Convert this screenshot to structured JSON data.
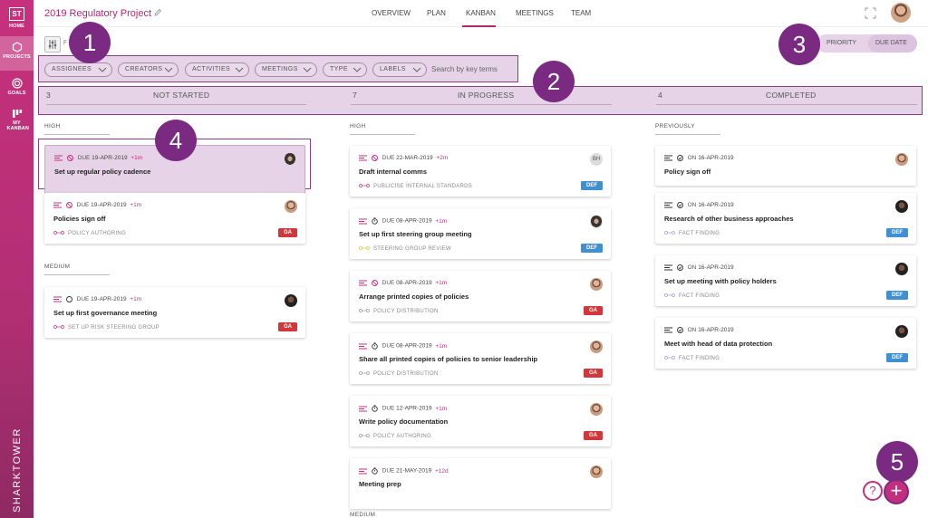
{
  "sidebar": {
    "logo": "ST",
    "items": [
      {
        "label": "HOME",
        "icon": "home-icon"
      },
      {
        "label": "PROJECTS",
        "icon": "hexagon-icon",
        "active": true
      },
      {
        "label": "GOALS",
        "icon": "target-icon"
      },
      {
        "label": "MY KANBAN",
        "icon": "kanban-icon"
      }
    ],
    "brand": "SHARKTOWER"
  },
  "header": {
    "project_title": "2019 Regulatory Project",
    "nav": [
      "OVERVIEW",
      "PLAN",
      "KANBAN",
      "MEETINGS",
      "TEAM"
    ],
    "active_nav": "KANBAN"
  },
  "filters": {
    "label": "F",
    "chips": [
      "ASSIGNEES",
      "CREATORS",
      "ACTIVITIES",
      "MEETINGS",
      "TYPE",
      "LABELS"
    ],
    "search_placeholder": "Search by key terms"
  },
  "sort_toggle": {
    "options": [
      "PRIORITY",
      "DUE DATE"
    ],
    "selected": "DUE DATE"
  },
  "columns": [
    {
      "count": "3",
      "title": "NOT STARTED"
    },
    {
      "count": "7",
      "title": "IN PROGRESS"
    },
    {
      "count": "4",
      "title": "COMPLETED"
    }
  ],
  "groups": {
    "col1_high": "HIGH",
    "col1_medium": "MEDIUM",
    "col2_high": "HIGH",
    "col2_medium": "MEDIUM",
    "col3_previously": "PREVIOUSLY"
  },
  "cards": {
    "c1": {
      "prefix": "DUE",
      "date": "19-APR-2019",
      "extra": "+1m",
      "title": "Set up regular policy cadence",
      "footer": "",
      "badge": ""
    },
    "c2": {
      "prefix": "DUE",
      "date": "19-APR-2019",
      "extra": "+1m",
      "title": "Policies sign off",
      "footer": "POLICY AUTHORING",
      "badge": "GA"
    },
    "c3": {
      "prefix": "DUE",
      "date": "19-APR-2019",
      "extra": "+1m",
      "title": "Set up first governance meeting",
      "footer": "SET UP RISK STEERING GROUP",
      "badge": "GA"
    },
    "p1": {
      "prefix": "DUE",
      "date": "22-MAR-2019",
      "extra": "+2m",
      "title": "Draft internal comms",
      "footer": "PUBLICISE INTERNAL STANDARDS",
      "badge": "DEF",
      "avatar": "BH"
    },
    "p2": {
      "prefix": "DUE",
      "date": "08-APR-2019",
      "extra": "+1m",
      "title": "Set up first steering group meeting",
      "footer": "STEERING GROUP REVIEW",
      "badge": "DEF"
    },
    "p3": {
      "prefix": "DUE",
      "date": "08-APR-2019",
      "extra": "+1m",
      "title": "Arrange printed copies of policies",
      "footer": "POLICY DISTRIBUTION",
      "badge": "GA"
    },
    "p4": {
      "prefix": "DUE",
      "date": "08-APR-2019",
      "extra": "+1m",
      "title": "Share all printed copies of policies to senior leadership",
      "footer": "POLICY DISTRIBUTION",
      "badge": "GA"
    },
    "p5": {
      "prefix": "DUE",
      "date": "12-APR-2019",
      "extra": "+1m",
      "title": "Write policy documentation",
      "footer": "POLICY AUTHORING",
      "badge": "GA"
    },
    "p6": {
      "prefix": "DUE",
      "date": "21-MAY-2019",
      "extra": "+12d",
      "title": "Meeting prep",
      "footer": "",
      "badge": ""
    },
    "d1": {
      "prefix": "ON",
      "date": "16-APR-2019",
      "extra": "",
      "title": "Policy sign off",
      "footer": "",
      "badge": ""
    },
    "d2": {
      "prefix": "ON",
      "date": "16-APR-2019",
      "extra": "",
      "title": "Research of other business approaches",
      "footer": "FACT FINDING",
      "badge": "DEF"
    },
    "d3": {
      "prefix": "ON",
      "date": "16-APR-2019",
      "extra": "",
      "title": "Set up meeting with policy holders",
      "footer": "FACT FINDING",
      "badge": "DEF"
    },
    "d4": {
      "prefix": "ON",
      "date": "16-APR-2019",
      "extra": "",
      "title": "Meet with head of data protection",
      "footer": "FACT FINDING",
      "badge": "DEF"
    }
  },
  "callouts": [
    "1",
    "2",
    "3",
    "4",
    "5"
  ],
  "fab": {
    "help": "?",
    "add": "+"
  },
  "colors": {
    "brand": "#c2307d",
    "highlight_fill": "#e6d3e8",
    "highlight_border": "#8b3d8c",
    "callout": "#7b2a82",
    "badge_ga": "#d0393b",
    "badge_def": "#3f8fd2"
  }
}
